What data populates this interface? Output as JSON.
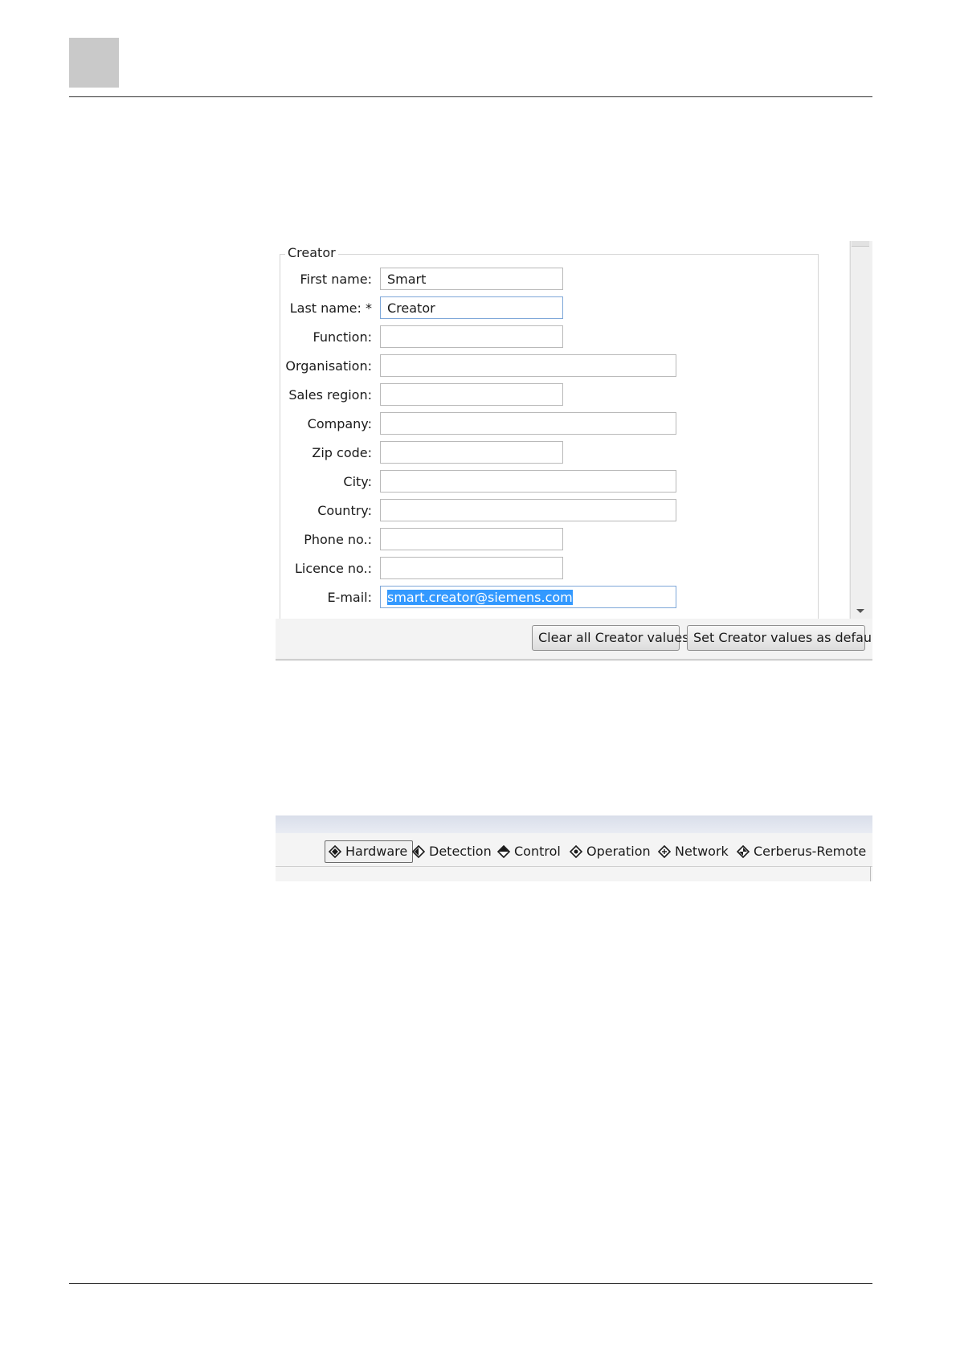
{
  "creator_dialog": {
    "group_title": "Creator",
    "fields": [
      {
        "label": "First name:",
        "value": "Smart",
        "width": "short"
      },
      {
        "label": "Last name: *",
        "value": "Creator",
        "width": "short"
      },
      {
        "label": "Function:",
        "value": "",
        "width": "short"
      },
      {
        "label": "Organisation:",
        "value": "",
        "width": "long"
      },
      {
        "label": "Sales region:",
        "value": "",
        "width": "short"
      },
      {
        "label": "Company:",
        "value": "",
        "width": "long"
      },
      {
        "label": "Zip code:",
        "value": "",
        "width": "short"
      },
      {
        "label": "City:",
        "value": "",
        "width": "long"
      },
      {
        "label": "Country:",
        "value": "",
        "width": "long"
      },
      {
        "label": "Phone no.:",
        "value": "",
        "width": "short"
      },
      {
        "label": "Licence no.:",
        "value": "",
        "width": "short"
      },
      {
        "label": "E-mail:",
        "value": "smart.creator@siemens.com",
        "width": "long"
      }
    ],
    "buttons": {
      "clear": "Clear all Creator values",
      "set_default": "Set Creator values as default"
    }
  },
  "tab_bar": {
    "tabs": [
      {
        "label": "Hardware",
        "icon": "diamond-hardware-icon",
        "active": true
      },
      {
        "label": "Detection",
        "icon": "diamond-detection-icon",
        "active": false
      },
      {
        "label": "Control",
        "icon": "diamond-control-icon",
        "active": false
      },
      {
        "label": "Operation",
        "icon": "diamond-operation-icon",
        "active": false
      },
      {
        "label": "Network",
        "icon": "diamond-network-icon",
        "active": false
      },
      {
        "label": "Cerberus-Remote",
        "icon": "diamond-cerberus-remote-icon",
        "active": false
      }
    ]
  },
  "colors": {
    "selection": "#3399ff",
    "focus_border": "#7ea7d8",
    "page_marker": "#c9c9c9"
  }
}
